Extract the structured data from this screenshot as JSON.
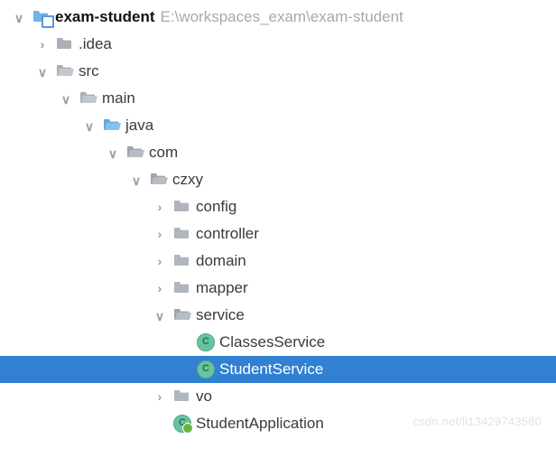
{
  "root": {
    "name": "exam-student",
    "path": "E:\\workspaces_exam\\exam-student"
  },
  "nodes": {
    "idea": ".idea",
    "src": "src",
    "main": "main",
    "java": "java",
    "com": "com",
    "czxy": "czxy",
    "config": "config",
    "controller": "controller",
    "domain": "domain",
    "mapper": "mapper",
    "service": "service",
    "classesService": "ClassesService",
    "studentService": "StudentService",
    "vo": "vo",
    "studentApplication": "StudentApplication"
  },
  "watermark": "csdn.net/li13429743580"
}
